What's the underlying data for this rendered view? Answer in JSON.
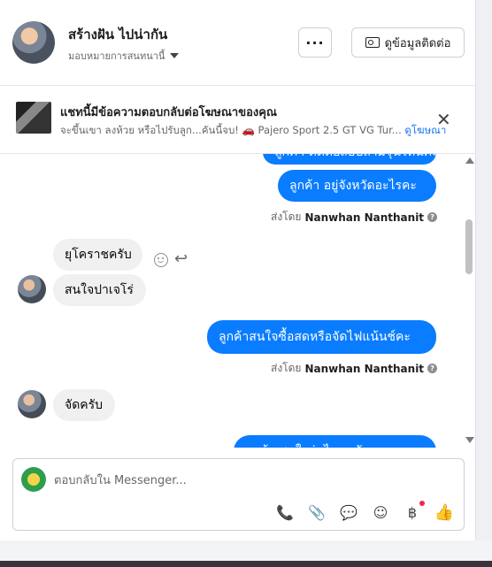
{
  "header": {
    "name": "สร้างฝัน ไปน่ากัน",
    "subtitle": "มอบหมายการสนทนานี้",
    "more_label": "···",
    "contact_label": "ดูข้อมูลติดต่อ"
  },
  "ad": {
    "title": "แชทนี้มีข้อความตอบกลับต่อโฆษณาของคุณ",
    "body": "จะขึ้นเขา ลงห้วย หรือไปรับลูก...คันนี้จบ! 🚗 Pajero Sport 2.5 GT VG Tur...",
    "link": "ดูโฆษณา"
  },
  "messages": {
    "partial_top": "ลูกค้า ติดต่อสอบถามรุ่นไหนคะ",
    "m1": "ลูกค้า อยู่จังหวัดอะไรคะ",
    "m2": "ยุโคราชครับ",
    "m3": "สนใจปาเจโร่",
    "m4": "ลูกค้าสนใจซื้อสดหรือจัดไฟแน้นช์คะ",
    "m5": "จัดครับ",
    "partial_bottom": "ลูกค้า สนใจรุ่นไหนครับ"
  },
  "sent_by": {
    "prefix": "ส่งโดย",
    "name": "Nanwhan Nanthanit"
  },
  "composer": {
    "placeholder": "ตอบกลับใน Messenger..."
  },
  "icons": {
    "reply": "↩",
    "close": "✕",
    "call": "📞",
    "attach": "📎",
    "chat": "💬",
    "emoji": "☺",
    "baht": "฿",
    "like": "👍"
  }
}
